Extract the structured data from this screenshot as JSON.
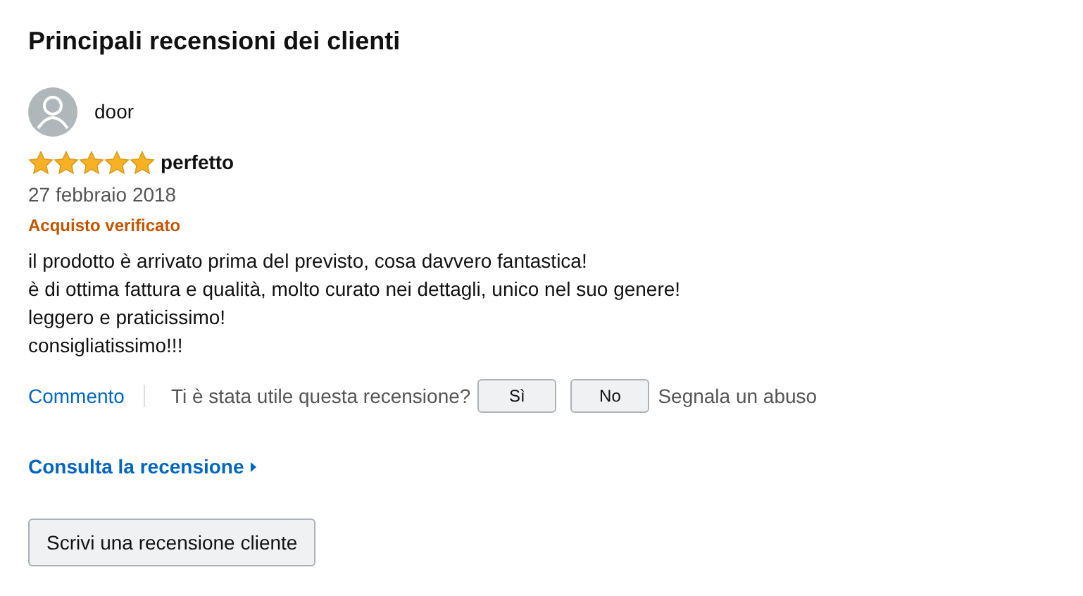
{
  "heading": "Principali recensioni dei clienti",
  "review": {
    "author": "door",
    "stars": 5,
    "title": "perfetto",
    "date": "27 febbraio 2018",
    "badge": "Acquisto verificato",
    "body": [
      "il prodotto è arrivato prima del previsto, cosa davvero fantastica!",
      "è di ottima fattura e qualità, molto curato nei dettagli, unico nel suo genere!",
      "leggero e praticissimo!",
      "consigliatissimo!!!"
    ],
    "comment_link": "Commento",
    "helpful_question": "Ti è stata utile questa recensione?",
    "yes_button": "Sì",
    "no_button": "No",
    "report_link": "Segnala un abuso"
  },
  "see_review_link": "Consulta la recensione",
  "write_button": "Scrivi una recensione cliente"
}
